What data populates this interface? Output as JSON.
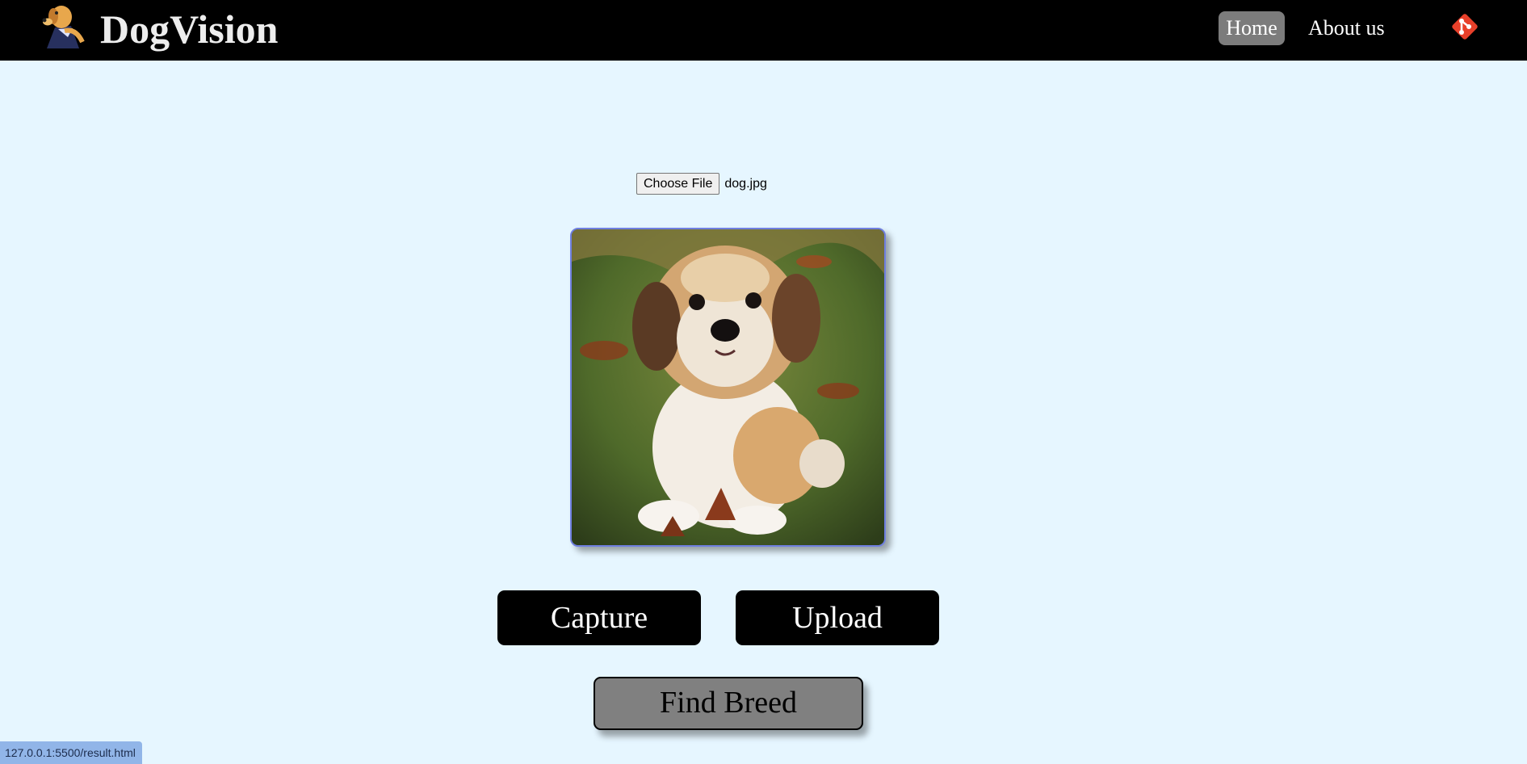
{
  "navbar": {
    "brand": "DogVision",
    "logo_icon": "dog-mascot-icon",
    "links": [
      {
        "label": "Home",
        "active": true
      },
      {
        "label": "About us",
        "active": false
      }
    ],
    "git_icon": "git-icon",
    "accent_color": "#e8402a"
  },
  "upload": {
    "choose_file_label": "Choose File",
    "file_name": "dog.jpg"
  },
  "preview": {
    "image": "puppy-photo"
  },
  "actions": {
    "capture_label": "Capture",
    "upload_label": "Upload",
    "find_breed_label": "Find Breed"
  },
  "status_bar": {
    "url": "127.0.0.1:5500/result.html"
  }
}
